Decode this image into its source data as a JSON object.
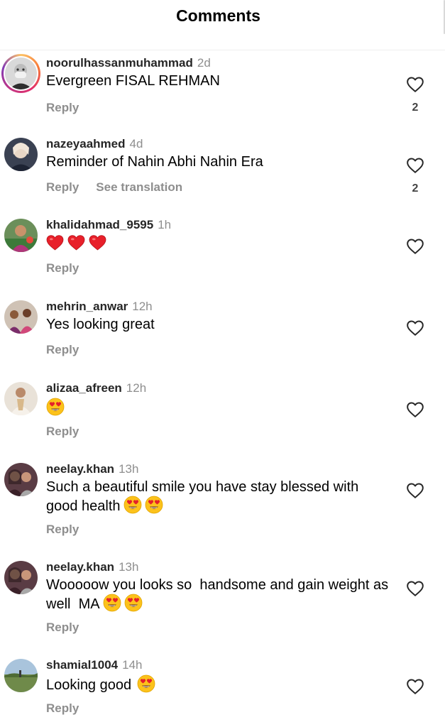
{
  "header": {
    "title": "Comments"
  },
  "comments": [
    {
      "username": "noorulhassanmuhammad",
      "time": "2d",
      "text": "Evergreen FISAL REHMAN",
      "reply": "Reply",
      "likes": "2",
      "avatar": "user-avatar-man-grey-beard"
    },
    {
      "username": "nazeyaahmed",
      "time": "4d",
      "text": "Reminder of Nahin Abhi Nahin Era",
      "reply": "Reply",
      "translation": "See translation",
      "likes": "2",
      "avatar": "user-avatar-woman-portrait"
    },
    {
      "username": "khalidahmad_9595",
      "time": "1h",
      "text": "",
      "emoji": [
        "red-heart",
        "red-heart",
        "red-heart"
      ],
      "reply": "Reply",
      "avatar": "user-avatar-man-outdoor"
    },
    {
      "username": "mehrin_anwar",
      "time": "12h",
      "text": "Yes looking great",
      "reply": "Reply",
      "avatar": "user-avatar-group-photo"
    },
    {
      "username": "alizaa_afreen",
      "time": "12h",
      "text": "",
      "emoji": [
        "heart-eyes"
      ],
      "reply": "Reply",
      "avatar": "user-avatar-light-outfit"
    },
    {
      "username": "neelay.khan",
      "time": "13h",
      "text": "Such a beautiful smile you have stay blessed with good health",
      "emoji": [
        "heart-eyes",
        "heart-eyes"
      ],
      "reply": "Reply",
      "avatar": "user-avatar-two-women"
    },
    {
      "username": "neelay.khan",
      "time": "13h",
      "text": "Wooooow you looks so  handsome and gain weight as well  MA",
      "emoji": [
        "heart-eyes",
        "heart-eyes"
      ],
      "reply": "Reply",
      "avatar": "user-avatar-two-women"
    },
    {
      "username": "shamial1004",
      "time": "14h",
      "text": "Looking good",
      "emoji": [
        "heart-eyes"
      ],
      "reply": "Reply",
      "avatar": "user-avatar-field-landscape"
    }
  ],
  "colors": {
    "username": "#262626",
    "muted": "#8e8e8e",
    "heart": "#e0245e",
    "divider": "#efefef"
  }
}
